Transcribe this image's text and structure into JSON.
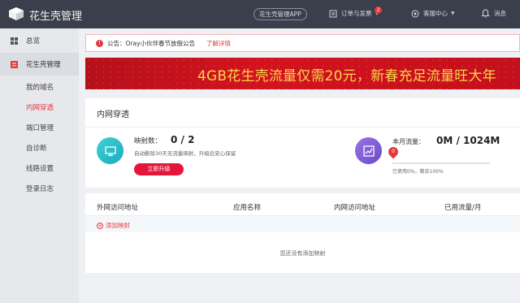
{
  "header": {
    "app_title": "花生壳管理",
    "app_button": "花生壳管理APP",
    "orders_label": "订单与发票",
    "orders_badge": "2",
    "service_label": "客服中心",
    "messages_label": "消息"
  },
  "sidebar": {
    "overview": "总览",
    "group": "花生壳管理",
    "items": [
      "我的域名",
      "内网穿透",
      "端口管理",
      "自诊断",
      "线路设置",
      "登录日志"
    ],
    "active_item": "内网穿透"
  },
  "notice": {
    "text": "公告：Oray小伙伴春节放假公告",
    "link": "了解详情"
  },
  "banner": {
    "text": "4GB花生壳流量仅需20元，新春充足流量旺大年"
  },
  "penetration": {
    "title": "内网穿透",
    "map_label": "映射数：",
    "map_count": "0 / 2",
    "map_desc": "自动删除30天无流量映射，升级后安心保留",
    "upgrade_button": "立即升级",
    "flow_label": "本月流量：",
    "flow_value": "0M / 1024M",
    "flow_pin": "0",
    "flow_percent": 0,
    "flow_desc": "已使用0%，剩余100%"
  },
  "table": {
    "columns": [
      "外网访问地址",
      "应用名称",
      "内网访问地址",
      "已用流量/月"
    ],
    "add_link": "添加映射",
    "empty_text": "您还没有添加映射"
  },
  "colors": {
    "accent": "#e4393c",
    "topbar": "#3a3f4b",
    "sidebar": "#e7e8ec",
    "banner_text": "#f7d64a"
  }
}
